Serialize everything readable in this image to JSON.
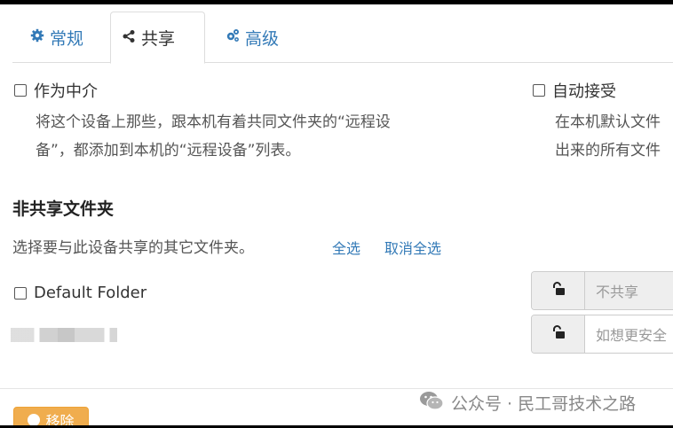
{
  "tabs": [
    {
      "label": "常规",
      "icon": "gear-icon"
    },
    {
      "label": "共享",
      "icon": "share-icon"
    },
    {
      "label": "高级",
      "icon": "cogs-icon"
    }
  ],
  "active_tab": "共享",
  "introducer": {
    "label": "作为中介",
    "checked": false,
    "help_line1": "将这个设备上那些，跟本机有着共同文件夹的“远程设",
    "help_line2": "备”，都添加到本机的“远程设备”列表。"
  },
  "auto_accept": {
    "label": "自动接受",
    "checked": false,
    "help_line1": "在本机默认文件",
    "help_line2": "出来的所有文件"
  },
  "unshared": {
    "title": "非共享文件夹",
    "description": "选择要与此设备共享的其它文件夹。",
    "select_all": "全选",
    "deselect_all": "取消全选"
  },
  "folders": [
    {
      "label": "Default Folder",
      "checked": false,
      "lock_icon": "unlock-icon",
      "field_placeholder": "不共享",
      "field_disabled": true
    },
    {
      "label": "",
      "blurred": true,
      "lock_icon": "unlock-icon",
      "field_placeholder": "如想更安全"
    }
  ],
  "remove_button": "移除",
  "watermark": "公众号 · 民工哥技术之路",
  "colors": {
    "link": "#337ab7",
    "warning": "#f0ad4e",
    "addon_bg": "#eeeeee"
  }
}
